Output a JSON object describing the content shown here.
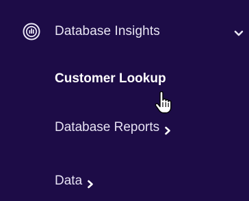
{
  "nav": {
    "section": {
      "label": "Database Insights",
      "icon": "database-chart-icon",
      "expanded": true
    },
    "items": [
      {
        "label": "Customer Lookup",
        "active": true,
        "has_submenu": false
      },
      {
        "label": "Database Reports",
        "active": false,
        "has_submenu": true
      },
      {
        "label": "Data",
        "active": false,
        "has_submenu": true
      }
    ]
  },
  "colors": {
    "background": "#1d0c47",
    "text": "#e9e6f4",
    "active_text": "#ffffff"
  },
  "cursor": {
    "icon": "hand-pointer-icon"
  }
}
